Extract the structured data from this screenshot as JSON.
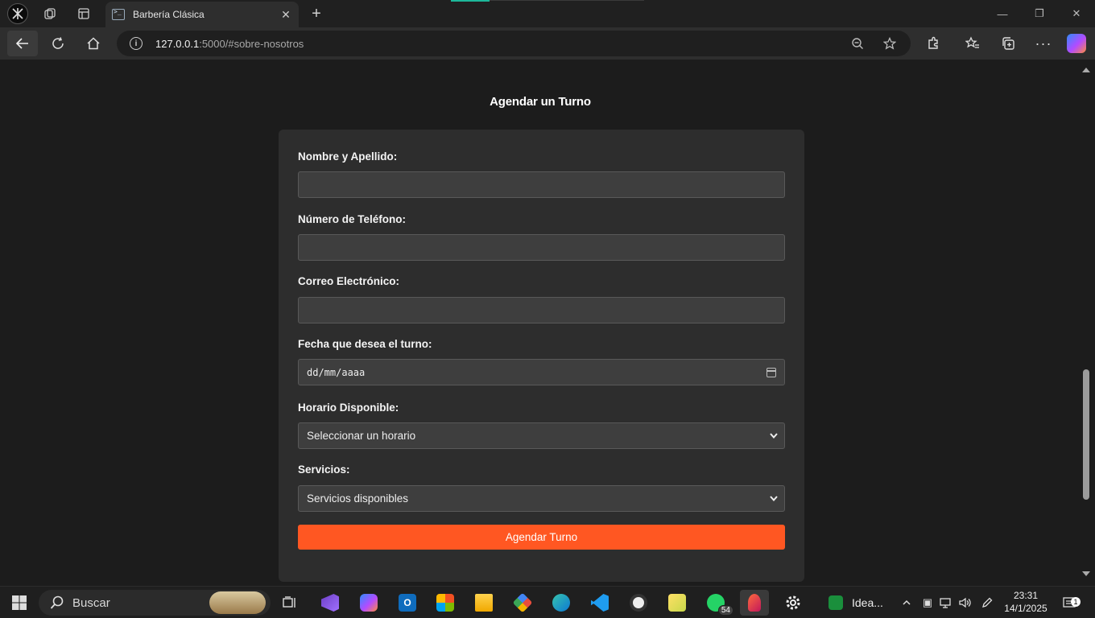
{
  "browser": {
    "tab_title": "Barbería Clásica",
    "url_host": "127.0.0.1",
    "url_rest": ":5000/#sobre-nosotros"
  },
  "page": {
    "section_title": "Agendar un Turno",
    "form": {
      "name_label": "Nombre y Apellido:",
      "name_value": "",
      "phone_label": "Número de Teléfono:",
      "phone_value": "",
      "email_label": "Correo Electrónico:",
      "email_value": "",
      "date_label": "Fecha que desea el turno:",
      "date_placeholder": "dd/mm/aaaa",
      "time_label": "Horario Disponible:",
      "time_selected": "Seleccionar un horario",
      "services_label": "Servicios:",
      "services_selected": "Servicios disponibles",
      "submit_label": "Agendar Turno"
    },
    "colors": {
      "accent": "#ff5722",
      "card": "#2d2d2d",
      "background": "#1c1c1c"
    }
  },
  "taskbar": {
    "search_label": "Buscar",
    "whatsapp_badge": "54",
    "ideas_label": "Idea...",
    "time": "23:31",
    "date": "14/1/2025",
    "notifications_count": "1"
  }
}
